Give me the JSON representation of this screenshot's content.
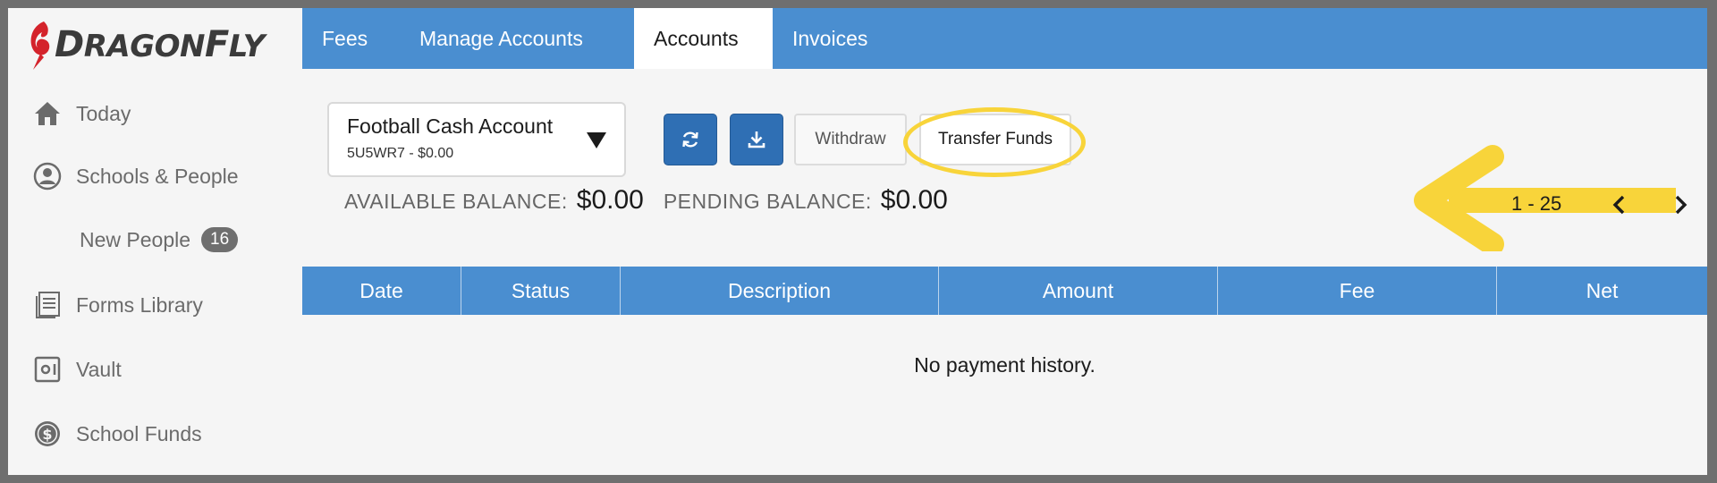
{
  "brand": {
    "logo_text": "DragonFly"
  },
  "sidebar": {
    "items": [
      {
        "label": "Today",
        "icon": "home-icon"
      },
      {
        "label": "Schools & People",
        "icon": "person-icon"
      },
      {
        "label": "New People",
        "badge": "16"
      },
      {
        "label": "Forms Library",
        "icon": "forms-icon"
      },
      {
        "label": "Vault",
        "icon": "vault-icon"
      },
      {
        "label": "School Funds",
        "icon": "dollar-coin-icon"
      }
    ]
  },
  "tabs": [
    {
      "label": "Fees",
      "active": false
    },
    {
      "label": "Manage Accounts",
      "active": false
    },
    {
      "label": "Accounts",
      "active": true
    },
    {
      "label": "Invoices",
      "active": false
    }
  ],
  "account": {
    "name": "Football Cash Account",
    "sub": "5U5WR7 - $0.00"
  },
  "toolbar": {
    "refresh_icon": "refresh-icon",
    "download_icon": "download-icon",
    "withdraw_label": "Withdraw",
    "transfer_label": "Transfer Funds",
    "highlight_color": "#f8d43a"
  },
  "balances": {
    "available_label": "AVAILABLE BALANCE:",
    "available_value": "$0.00",
    "pending_label": "PENDING BALANCE:",
    "pending_value": "$0.00"
  },
  "pager": {
    "range": "1 - 25"
  },
  "table": {
    "columns": [
      "Date",
      "Status",
      "Description",
      "Amount",
      "Fee",
      "Net"
    ],
    "empty_message": "No payment history."
  },
  "colors": {
    "primary_blue": "#4a8ed0",
    "button_blue": "#2f6fb4",
    "badge_gray": "#6f6f6f"
  }
}
